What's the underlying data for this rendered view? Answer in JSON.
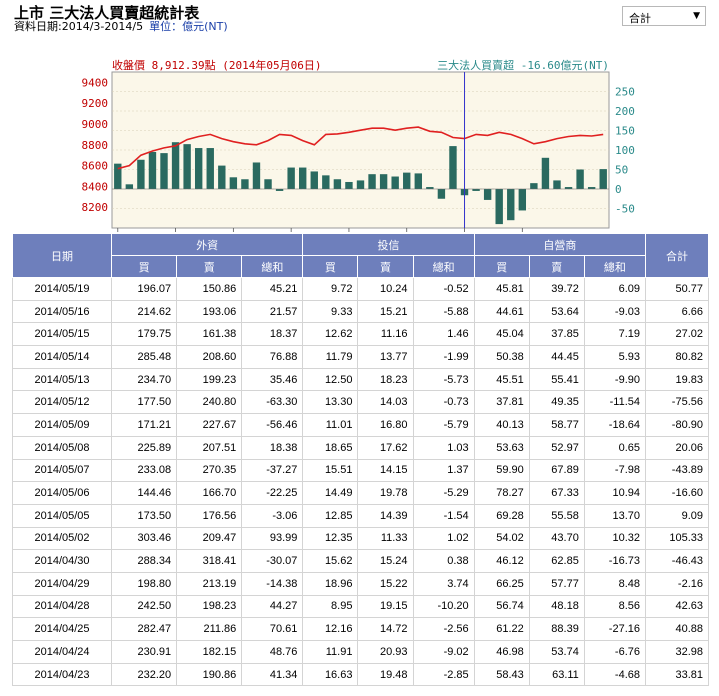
{
  "page": {
    "title": "上市 三大法人買賣超統計表",
    "date_label": "資料日期:2014/3-2014/5",
    "unit_label": "單位：億元(NT)"
  },
  "selector": {
    "selected": "合計",
    "arrow": "▼"
  },
  "chart_data": {
    "type": "bar+line",
    "left_label": "收盤價 8,912.39點 (2014年05月06日)",
    "right_label": "三大法人買賣超 -16.60億元(NT)",
    "left_axis": {
      "ticks": [
        8200,
        8400,
        8600,
        8800,
        9000,
        9200,
        9400
      ],
      "range": [
        8000,
        9500
      ]
    },
    "right_axis": {
      "ticks": [
        -50,
        0,
        50,
        100,
        150,
        200,
        250
      ],
      "range": [
        -100,
        300
      ]
    },
    "x_ticks": [
      "03/21",
      "03/28",
      "04/07",
      "04/14",
      "04/21",
      "04/28",
      "05/06",
      "05/13"
    ],
    "x_tick_index": [
      0,
      5,
      10,
      15,
      20,
      25,
      30,
      35
    ],
    "highlight_index": 30,
    "close_price": [
      8570,
      8600,
      8700,
      8740,
      8770,
      8790,
      8850,
      8880,
      8900,
      8860,
      8830,
      8810,
      8800,
      8840,
      8900,
      8890,
      8840,
      8800,
      8900,
      8905,
      8920,
      8940,
      8960,
      8960,
      8940,
      8960,
      8970,
      8930,
      8920,
      8870,
      8860,
      8900,
      8890,
      8920,
      8900,
      8860,
      8810,
      8830,
      8860,
      8880,
      8890,
      8885,
      8900
    ],
    "net_buy": [
      65,
      12,
      75,
      95,
      92,
      120,
      115,
      105,
      105,
      60,
      30,
      25,
      68,
      25,
      -5,
      55,
      55,
      45,
      35,
      25,
      18,
      22,
      38,
      38,
      32,
      42,
      40,
      5,
      -25,
      110,
      -16,
      -5,
      -28,
      -90,
      -80,
      -55,
      15,
      80,
      22,
      5,
      50,
      5,
      51
    ]
  },
  "table": {
    "date_header": "日期",
    "groups": [
      "外資",
      "投信",
      "自營商"
    ],
    "total_header": "合計",
    "subheaders": [
      "買",
      "賣",
      "總和"
    ],
    "rows": [
      [
        "2014/05/19",
        "196.07",
        "150.86",
        "45.21",
        "9.72",
        "10.24",
        "-0.52",
        "45.81",
        "39.72",
        "6.09",
        "50.77"
      ],
      [
        "2014/05/16",
        "214.62",
        "193.06",
        "21.57",
        "9.33",
        "15.21",
        "-5.88",
        "44.61",
        "53.64",
        "-9.03",
        "6.66"
      ],
      [
        "2014/05/15",
        "179.75",
        "161.38",
        "18.37",
        "12.62",
        "11.16",
        "1.46",
        "45.04",
        "37.85",
        "7.19",
        "27.02"
      ],
      [
        "2014/05/14",
        "285.48",
        "208.60",
        "76.88",
        "11.79",
        "13.77",
        "-1.99",
        "50.38",
        "44.45",
        "5.93",
        "80.82"
      ],
      [
        "2014/05/13",
        "234.70",
        "199.23",
        "35.46",
        "12.50",
        "18.23",
        "-5.73",
        "45.51",
        "55.41",
        "-9.90",
        "19.83"
      ],
      [
        "2014/05/12",
        "177.50",
        "240.80",
        "-63.30",
        "13.30",
        "14.03",
        "-0.73",
        "37.81",
        "49.35",
        "-11.54",
        "-75.56"
      ],
      [
        "2014/05/09",
        "171.21",
        "227.67",
        "-56.46",
        "11.01",
        "16.80",
        "-5.79",
        "40.13",
        "58.77",
        "-18.64",
        "-80.90"
      ],
      [
        "2014/05/08",
        "225.89",
        "207.51",
        "18.38",
        "18.65",
        "17.62",
        "1.03",
        "53.63",
        "52.97",
        "0.65",
        "20.06"
      ],
      [
        "2014/05/07",
        "233.08",
        "270.35",
        "-37.27",
        "15.51",
        "14.15",
        "1.37",
        "59.90",
        "67.89",
        "-7.98",
        "-43.89"
      ],
      [
        "2014/05/06",
        "144.46",
        "166.70",
        "-22.25",
        "14.49",
        "19.78",
        "-5.29",
        "78.27",
        "67.33",
        "10.94",
        "-16.60"
      ],
      [
        "2014/05/05",
        "173.50",
        "176.56",
        "-3.06",
        "12.85",
        "14.39",
        "-1.54",
        "69.28",
        "55.58",
        "13.70",
        "9.09"
      ],
      [
        "2014/05/02",
        "303.46",
        "209.47",
        "93.99",
        "12.35",
        "11.33",
        "1.02",
        "54.02",
        "43.70",
        "10.32",
        "105.33"
      ],
      [
        "2014/04/30",
        "288.34",
        "318.41",
        "-30.07",
        "15.62",
        "15.24",
        "0.38",
        "46.12",
        "62.85",
        "-16.73",
        "-46.43"
      ],
      [
        "2014/04/29",
        "198.80",
        "213.19",
        "-14.38",
        "18.96",
        "15.22",
        "3.74",
        "66.25",
        "57.77",
        "8.48",
        "-2.16"
      ],
      [
        "2014/04/28",
        "242.50",
        "198.23",
        "44.27",
        "8.95",
        "19.15",
        "-10.20",
        "56.74",
        "48.18",
        "8.56",
        "42.63"
      ],
      [
        "2014/04/25",
        "282.47",
        "211.86",
        "70.61",
        "12.16",
        "14.72",
        "-2.56",
        "61.22",
        "88.39",
        "-27.16",
        "40.88"
      ],
      [
        "2014/04/24",
        "230.91",
        "182.15",
        "48.76",
        "11.91",
        "20.93",
        "-9.02",
        "46.98",
        "53.74",
        "-6.76",
        "32.98"
      ],
      [
        "2014/04/23",
        "232.20",
        "190.86",
        "41.34",
        "16.63",
        "19.48",
        "-2.85",
        "58.43",
        "63.11",
        "-4.68",
        "33.81"
      ]
    ]
  },
  "colors": {
    "header_bg": "#6e7fbc",
    "price_line": "#e02020",
    "bar": "#2a6a60",
    "left_axis": "#c00000",
    "right_axis": "#2a8a8a",
    "highlight": "#3333cc",
    "plot_bg": "#fbf7e9"
  }
}
